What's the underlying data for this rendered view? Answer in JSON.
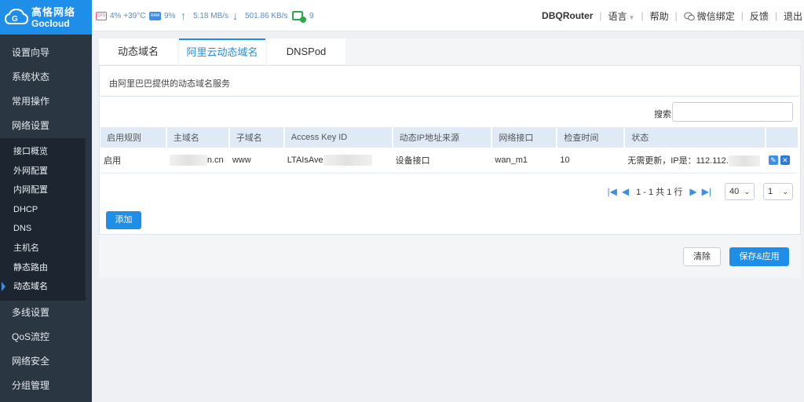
{
  "brand": {
    "name_cn": "高恪网络",
    "name_en": "Gocloud"
  },
  "sidebar": {
    "items_top": [
      "设置向导",
      "系统状态",
      "常用操作",
      "网络设置"
    ],
    "submenu": [
      "接口概览",
      "外网配置",
      "内网配置",
      "DHCP",
      "DNS",
      "主机名",
      "静态路由",
      "动态域名"
    ],
    "active_sub": "动态域名",
    "items_bottom": [
      "多线设置",
      "QoS流控",
      "网络安全",
      "分组管理"
    ]
  },
  "topbar": {
    "cpu_label": "CPU",
    "cpu": "4% +39°C",
    "ram_label": "RAM",
    "ram": "9%",
    "upload": "5.18 MB/s",
    "download": "501.86 KB/s",
    "devices": "9",
    "router_name": "DBQRouter",
    "language": "语言",
    "help": "帮助",
    "wechat": "微信绑定",
    "feedback": "反馈",
    "logout": "退出"
  },
  "tabs": [
    "动态域名",
    "阿里云动态域名",
    "DNSPod"
  ],
  "active_tab": "阿里云动态域名",
  "panel": {
    "description": "由阿里巴巴提供的动态域名服务",
    "search_label": "搜索:",
    "columns": [
      "启用规则",
      "主域名",
      "子域名",
      "Access Key ID",
      "动态IP地址来源",
      "网络接口",
      "检查时间",
      "状态"
    ],
    "row": {
      "enabled": "启用",
      "domain": "n.cn",
      "subdomain": "www",
      "access_key": "LTAIsAve",
      "ip_source": "设备接口",
      "interface": "wan_m1",
      "interval": "10",
      "status": "无需更新，IP是：112.112."
    },
    "pager": {
      "summary": "1 - 1 共 1 行",
      "page_size": "40",
      "page": "1"
    },
    "add_label": "添加"
  },
  "buttons": {
    "clear": "清除",
    "save": "保存&应用"
  },
  "colors": {
    "accent": "#1f8ee8",
    "sidebar_bg": "#2b3643"
  }
}
